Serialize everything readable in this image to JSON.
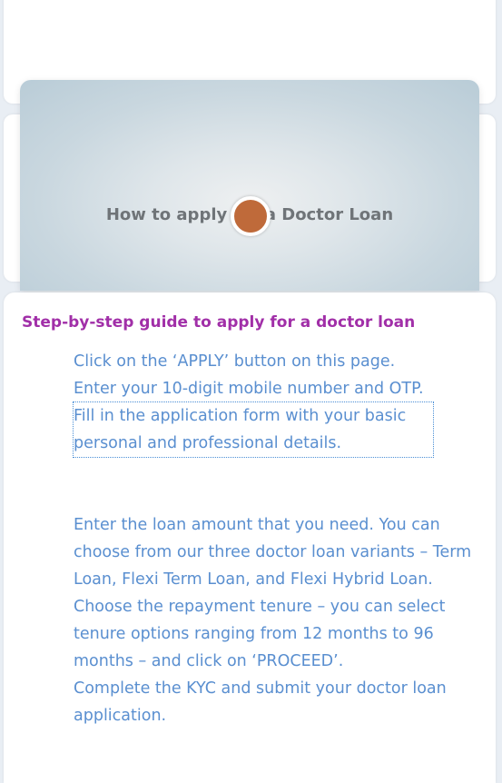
{
  "video": {
    "title": "How to apply for a Doctor Loan"
  },
  "guide": {
    "heading": "Step-by-step guide to apply for a doctor loan",
    "steps": [
      "Click on the ‘APPLY’ button on this page.",
      "Enter your 10-digit mobile number and OTP.",
      "Fill in the application form with your basic personal and professional details.",
      "Enter the loan amount that you need. You can choose from our three doctor loan variants – Term Loan, Flexi Term Loan, and Flexi Hybrid Loan.",
      "Choose the repayment tenure – you can select tenure options ranging from 12 months to 96 months – and click on ‘PROCEED’.",
      "Complete the KYC and submit your doctor loan application."
    ]
  },
  "colors": {
    "heading": "#a12fa8",
    "step_text": "#5a8fd0",
    "play_button": "#bf6a3a"
  },
  "icons": {
    "play": "play-button-icon"
  }
}
